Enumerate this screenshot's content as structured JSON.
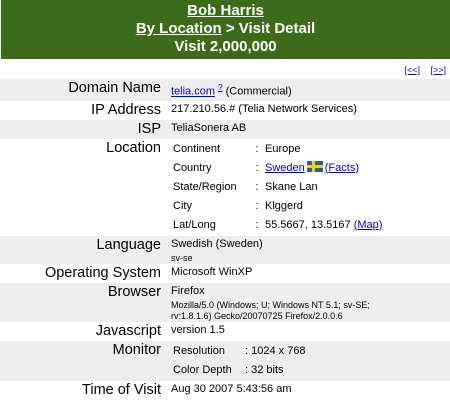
{
  "header": {
    "user": "Bob Harris",
    "crumb_link": "By Location",
    "crumb_sep": " > ",
    "crumb_current": "Visit Detail",
    "visit": "Visit 2,000,000",
    "bg_color": "#3d6b1c"
  },
  "nav": {
    "prev": "[<<]",
    "next": "[>>]"
  },
  "rows": {
    "domain": {
      "label": "Domain Name",
      "link": "telia.com",
      "help": "?",
      "suffix": " (Commercial)"
    },
    "ip": {
      "label": "IP Address",
      "value": "217.210.56.# (Telia Network Services)"
    },
    "isp": {
      "label": "ISP",
      "value": "TeliaSonera AB"
    },
    "location": {
      "label": "Location",
      "continent": {
        "key": "Continent",
        "value": "Europe"
      },
      "country": {
        "key": "Country",
        "value": "Sweden",
        "facts": "(Facts)",
        "flag_icon": "sweden-flag-icon"
      },
      "region": {
        "key": "State/Region",
        "value": "Skane Lan"
      },
      "city": {
        "key": "City",
        "value": "Klggerd"
      },
      "latlong": {
        "key": "Lat/Long",
        "value": "55.5667, 13.5167",
        "map": "(Map)"
      }
    },
    "language": {
      "label": "Language",
      "value": "Swedish (Sweden)",
      "code": "sv-se"
    },
    "os": {
      "label": "Operating System",
      "value": "Microsoft WinXP"
    },
    "browser": {
      "label": "Browser",
      "value": "Firefox",
      "ua1": "Mozilla/5.0 (Windows; U; Windows NT 5.1; sv-SE;",
      "ua2": "rv:1.8.1.6) Gecko/20070725 Firefox/2.0.0.6"
    },
    "javascript": {
      "label": "Javascript",
      "value": "version 1.5"
    },
    "monitor": {
      "label": "Monitor",
      "resolution_key": "Resolution",
      "resolution": ": 1024 x 768",
      "depth_key": "Color Depth",
      "depth": ": 32 bits"
    },
    "time": {
      "label": "Time of Visit",
      "value": "Aug 30 2007 5:43:56 am"
    }
  },
  "colon": ":"
}
